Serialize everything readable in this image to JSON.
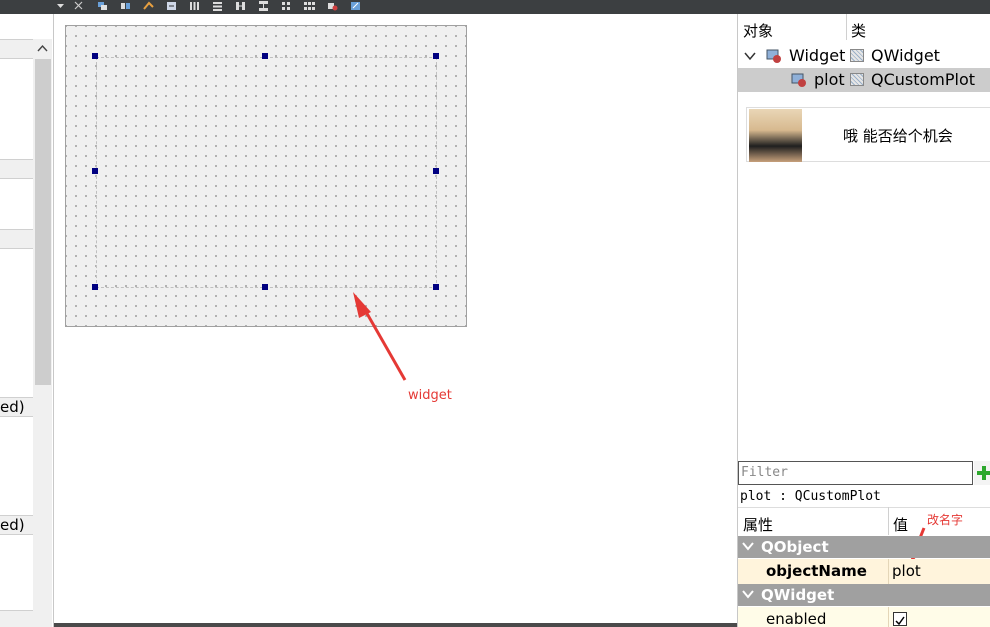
{
  "colors": {
    "annotation": "#e53935",
    "handle": "#000080",
    "group_row_bg": "#a0a0a0",
    "selected_row_bg": "#cccccc",
    "property_row_bg": "#fff4dc",
    "add_icon": "#2ea82e"
  },
  "left_panel": {
    "items": [
      "ed)",
      "ed)"
    ]
  },
  "canvas": {
    "annotation_label": "widget"
  },
  "object_inspector": {
    "col_object": "对象",
    "col_class": "类",
    "rows": [
      {
        "name": "Widget",
        "class": "QWidget",
        "expanded": true
      },
      {
        "name": "plot",
        "class": "QCustomPlot",
        "selected": true
      }
    ]
  },
  "ad": {
    "text": "哦 能否给个机会"
  },
  "property_editor": {
    "filter_placeholder": "Filter",
    "current_object": "plot : QCustomPlot",
    "col_property": "属性",
    "col_value": "值",
    "annotation_label": "改名字",
    "groups": [
      {
        "name": "QObject",
        "props": [
          {
            "name": "objectName",
            "value": "plot",
            "bold": true
          }
        ]
      },
      {
        "name": "QWidget",
        "props": [
          {
            "name": "enabled",
            "checked": true
          }
        ]
      }
    ]
  }
}
